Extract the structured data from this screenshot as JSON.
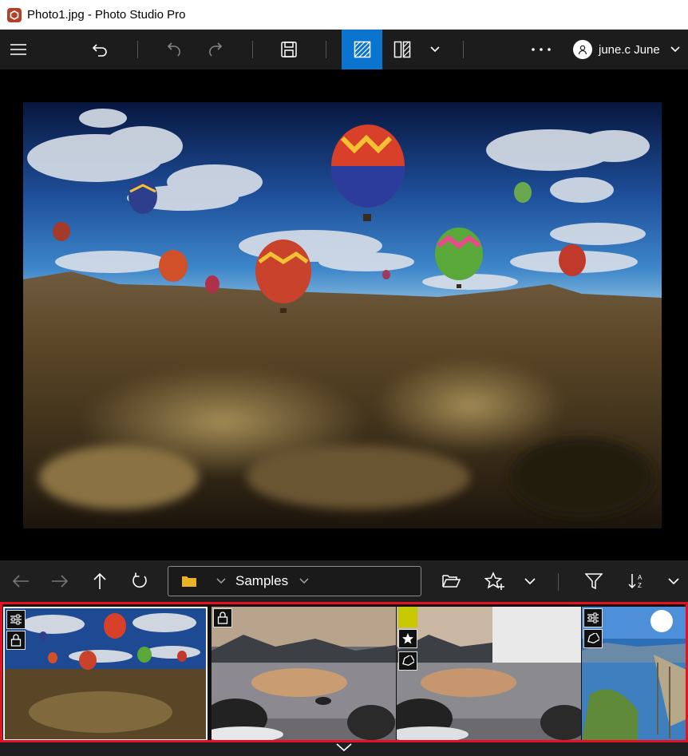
{
  "window": {
    "title": "Photo1.jpg - Photo Studio Pro"
  },
  "toolbar": {
    "menu_icon": "hamburger-icon",
    "undo_icon": "undo-icon",
    "redo_icon": "redo-icon",
    "save_icon": "save-icon",
    "view_single_icon": "single-view-icon",
    "view_compare_icon": "compare-view-icon",
    "more_icon": "more-icon",
    "user_label": "june.c June"
  },
  "navbar": {
    "path_label": "Samples",
    "back_icon": "arrow-left-icon",
    "forward_icon": "arrow-right-icon",
    "up_icon": "arrow-up-icon",
    "refresh_icon": "refresh-icon",
    "open_folder_icon": "open-folder-icon",
    "rating_icon": "star-add-icon",
    "filter_icon": "filter-icon",
    "sort_icon": "sort-az-icon"
  },
  "filmstrip": {
    "items": [
      {
        "name": "balloons",
        "badges": [
          "adjust",
          "lock"
        ],
        "selected": true
      },
      {
        "name": "lake-sunset",
        "badges": [
          "lock"
        ]
      },
      {
        "name": "lake-sunset-blur",
        "badges": [
          "color-label",
          "star",
          "tag"
        ],
        "color_label": "#c8c800"
      },
      {
        "name": "pier-lake",
        "badges": [
          "adjust",
          "tag"
        ]
      }
    ]
  },
  "colors": {
    "accent": "#0a74cf",
    "selection_border": "#e81123"
  }
}
